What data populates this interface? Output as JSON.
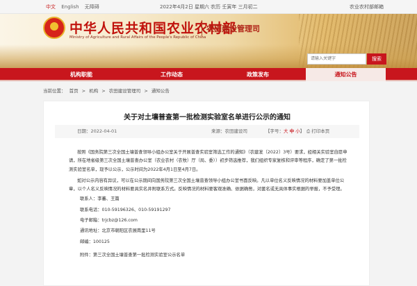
{
  "topbar": {
    "lang_cn": "中文",
    "lang_en": "English",
    "accessible": "无障碍",
    "date": "2022年4月2日 星期六 农历 壬寅年 三月初二",
    "right_link": "农业农村部邮箱"
  },
  "header": {
    "title": "中华人民共和国农业农村部",
    "subtitle": "Ministry of Agriculture and Rural Affairs of the People's Republic of China",
    "dept": "农田建设管理司",
    "search_placeholder": "请输入关键字",
    "search_button": "搜索"
  },
  "nav": [
    {
      "label": "机构职能"
    },
    {
      "label": "工作动态"
    },
    {
      "label": "政策发布"
    },
    {
      "label": "通知公告"
    }
  ],
  "breadcrumb": {
    "prefix": "当前位置：",
    "items": [
      "首页",
      "机构",
      "农田建设管理司",
      "通知公告"
    ],
    "separator": ">"
  },
  "article": {
    "title": "关于对土壤普查第一批检测实验室名单进行公示的通知",
    "date_label": "日期：",
    "date": "2022-04-01",
    "source_label": "来源：",
    "source": "农田建设司",
    "font_label": "【字号：",
    "font_big": "大",
    "font_mid": "中",
    "font_small": "小",
    "font_close": "】",
    "print": "打印本页",
    "para1": "按照《国务院第三次全国土壤普查领导小组办公室关于开展普查实验室筛选工作的通知》（农建发〔2022〕3号）要求，经相关实验室自愿申请，所在地省级第三次全国土壤普查办公室（农业农村（农牧）厅（局、委））初步筛选推荐，我们组织专家复核和评审等程序，确定了第一批检测实验室名单，现予以公示，公示时间为2022年4月1日至4月7日。",
    "para2": "如对公示内容有异议，可以在公示期间向国务院第三次全国土壤普查领导小组办公室书面反映。凡以单位名义反映情况的材料要加盖单位公章，以个人名义反映情况的材料要具实名并附联系方式。反映情况的材料要客观准确、依据确凿，对匿名或无具体事实根据的举报，不予受理。",
    "contact_label": "联系人：李蕃、王篇",
    "phone": "联系电话：010-59196326、010-59191297",
    "email": "电子邮箱：trjcbz@126.com",
    "address": "通讯地址：北京市朝阳区农展南里11号",
    "postcode": "邮编：100125",
    "attachment": "附件：第三次全国土壤普查第一批检测实验室公示名单"
  }
}
